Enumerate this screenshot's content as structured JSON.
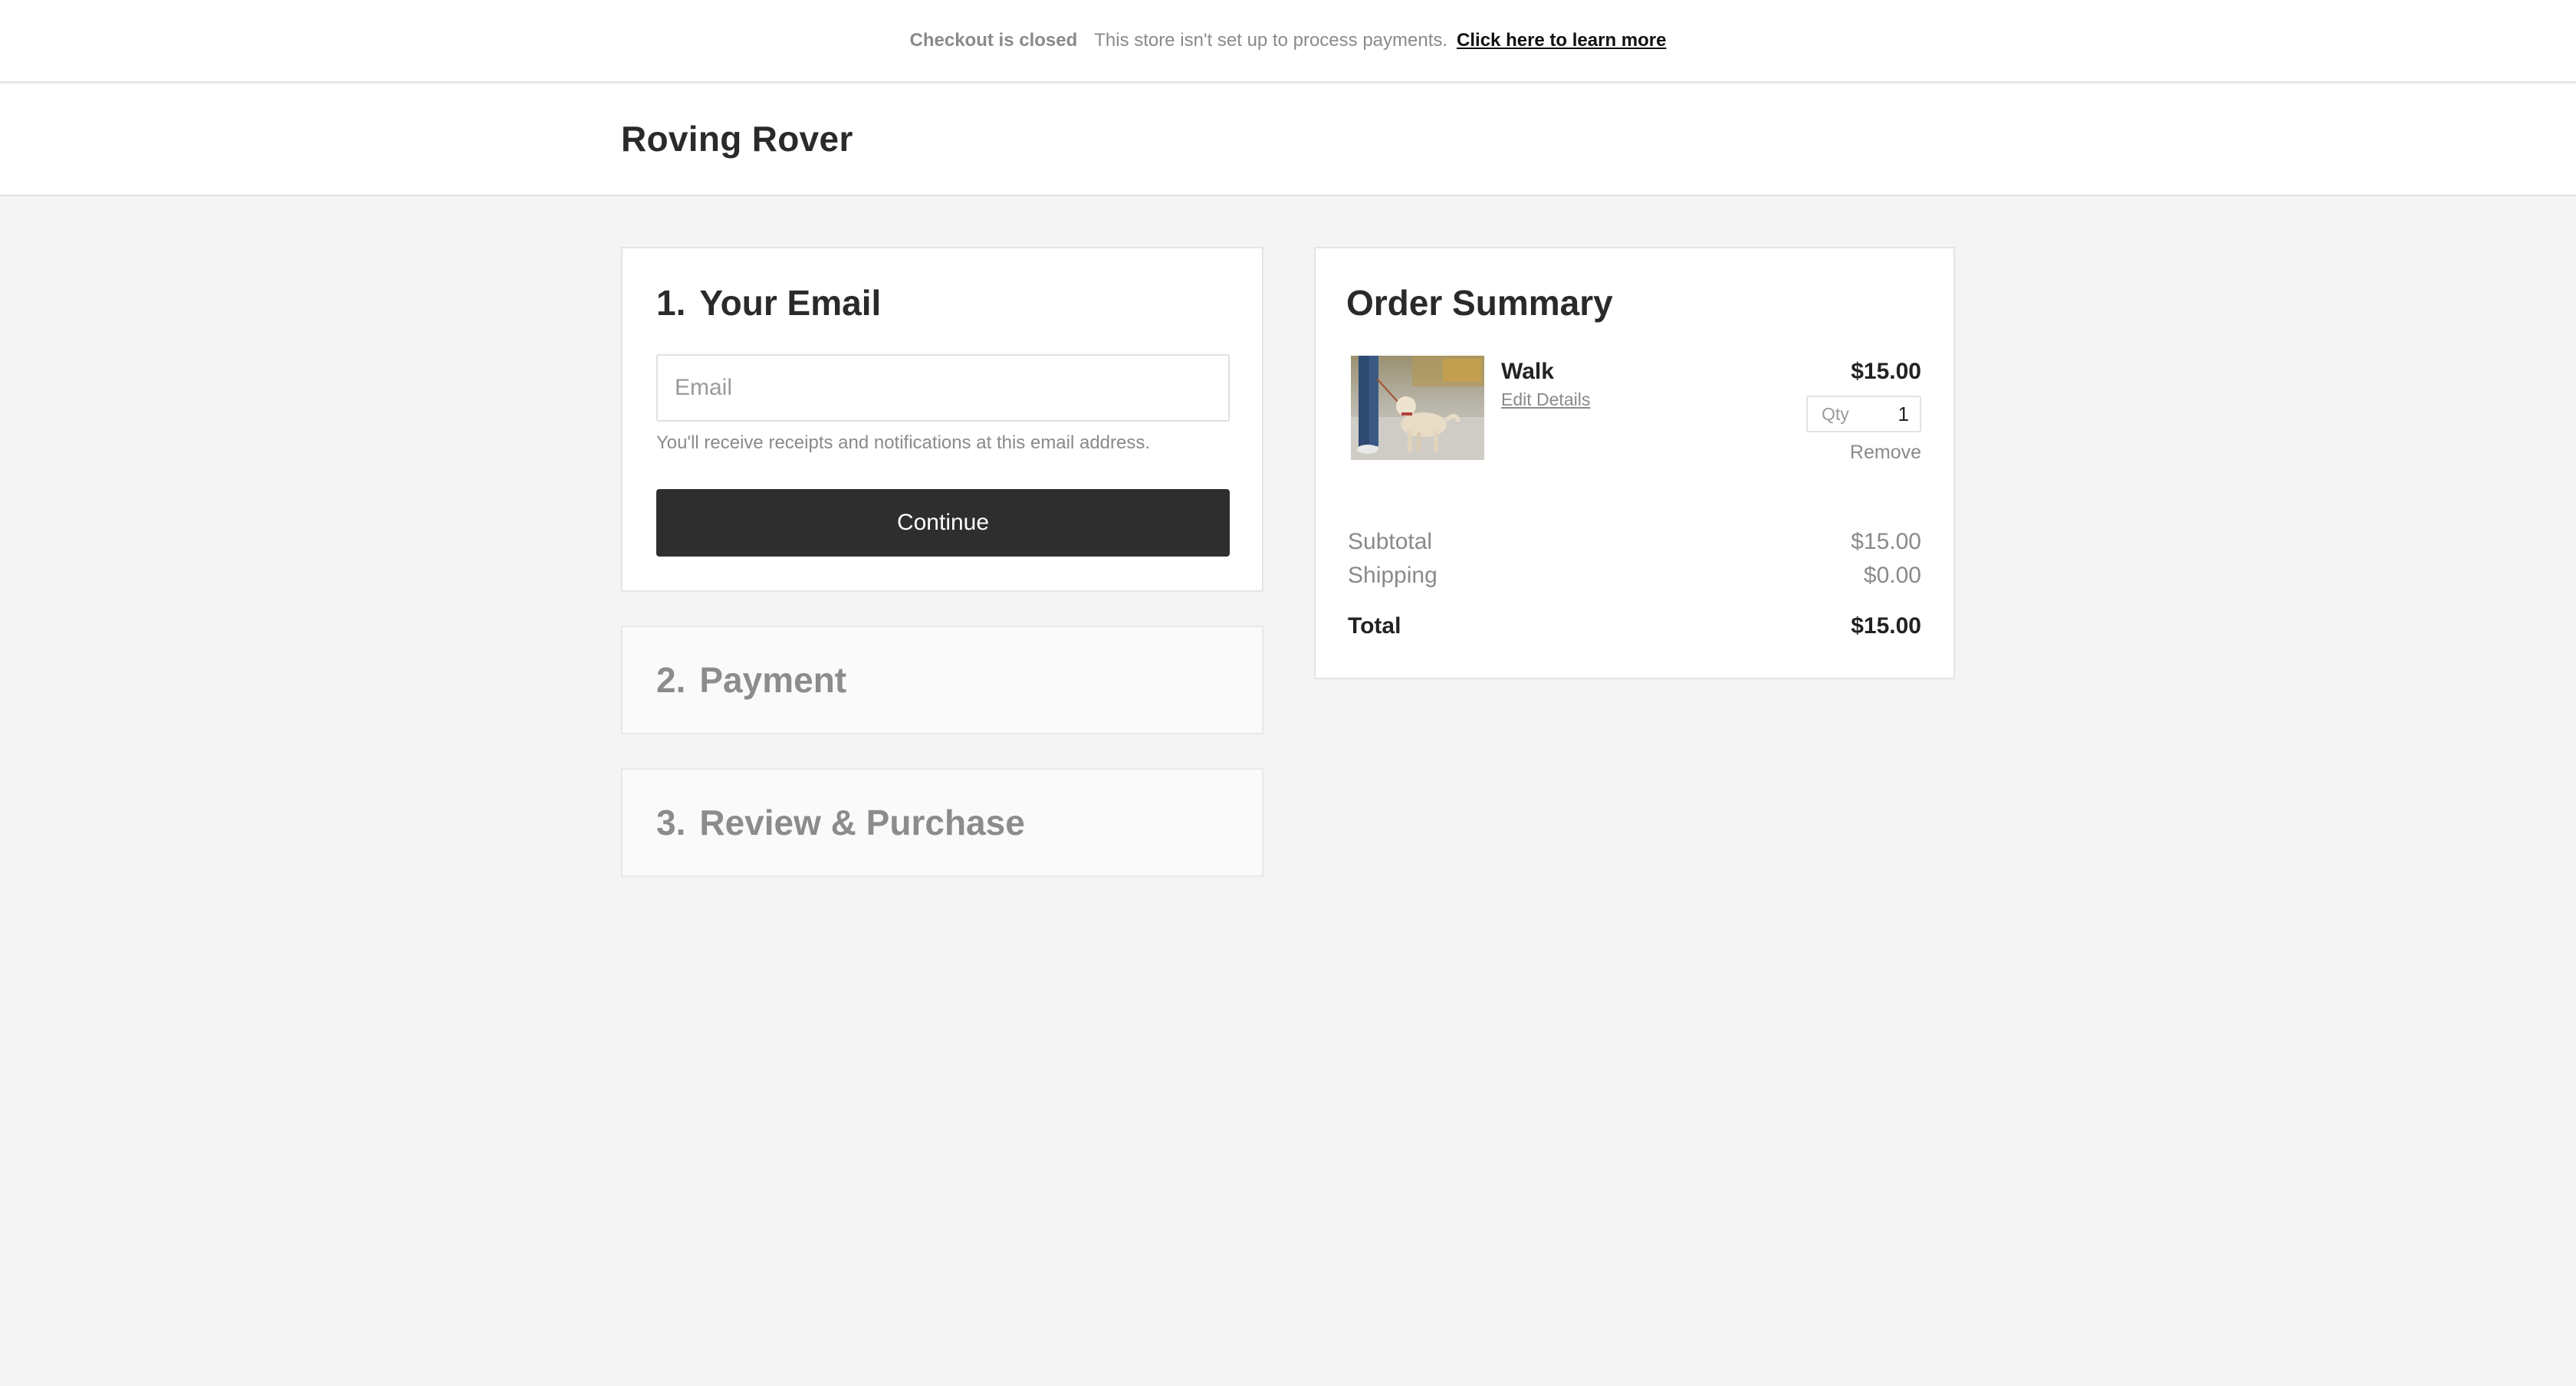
{
  "banner": {
    "closed_label": "Checkout is closed",
    "message": "This store isn't set up to process payments.",
    "learn_more": "Click here to learn more"
  },
  "header": {
    "store_name": "Roving Rover"
  },
  "steps": {
    "email": {
      "number": "1.",
      "title": "Your Email",
      "placeholder": "Email",
      "value": "",
      "hint": "You'll receive receipts and notifications at this email address.",
      "continue_label": "Continue"
    },
    "payment": {
      "number": "2.",
      "title": "Payment"
    },
    "review": {
      "number": "3.",
      "title": "Review & Purchase"
    }
  },
  "summary": {
    "title": "Order Summary",
    "item": {
      "name": "Walk",
      "edit_label": "Edit Details",
      "price": "$15.00",
      "qty_label": "Qty",
      "qty": "1",
      "remove_label": "Remove",
      "image_icon": "dog-walk-photo"
    },
    "subtotal_label": "Subtotal",
    "subtotal": "$15.00",
    "shipping_label": "Shipping",
    "shipping": "$0.00",
    "total_label": "Total",
    "total": "$15.00"
  },
  "colors": {
    "background": "#f4f4f4",
    "button": "#2e2e2e",
    "muted_text": "#8a8a8a"
  }
}
